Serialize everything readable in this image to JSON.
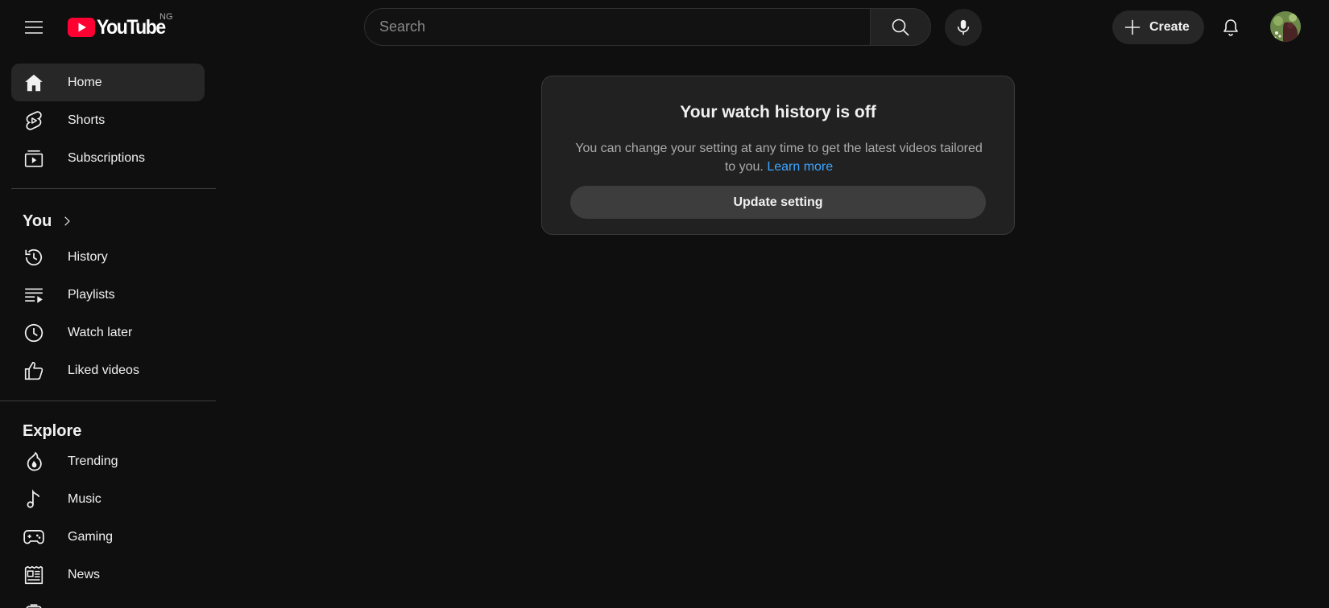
{
  "header": {
    "logo_text": "YouTube",
    "region_code": "NG",
    "search_placeholder": "Search",
    "create_label": "Create"
  },
  "sidebar": {
    "main": [
      {
        "label": "Home",
        "icon": "home-icon",
        "active": true
      },
      {
        "label": "Shorts",
        "icon": "shorts-icon"
      },
      {
        "label": "Subscriptions",
        "icon": "subscriptions-icon"
      }
    ],
    "you_title": "You",
    "you_items": [
      {
        "label": "History",
        "icon": "history-icon"
      },
      {
        "label": "Playlists",
        "icon": "playlists-icon"
      },
      {
        "label": "Watch later",
        "icon": "watch-later-icon"
      },
      {
        "label": "Liked videos",
        "icon": "like-icon"
      }
    ],
    "explore_title": "Explore",
    "explore_items": [
      {
        "label": "Trending",
        "icon": "trending-icon"
      },
      {
        "label": "Music",
        "icon": "music-icon"
      },
      {
        "label": "Gaming",
        "icon": "gaming-icon"
      },
      {
        "label": "News",
        "icon": "news-icon"
      }
    ]
  },
  "card": {
    "title": "Your watch history is off",
    "body": "You can change your setting at any time to get the latest videos tailored to you.",
    "link": "Learn more",
    "button": "Update setting"
  },
  "colors": {
    "background": "#0f0f0f",
    "brand_red": "#ff0033",
    "link_blue": "#3ea6ff",
    "active_item": "#272727"
  }
}
